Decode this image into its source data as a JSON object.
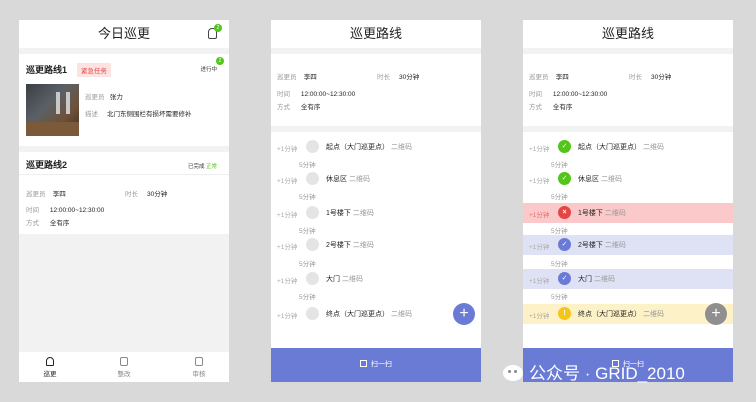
{
  "screen1": {
    "title": "今日巡更",
    "bell_badge": "2",
    "route1": {
      "name": "巡更路线1",
      "tag": "紧急任务",
      "status": "进行中",
      "status_badge": "2",
      "patroller_label": "巡更员",
      "patroller": "张力",
      "desc_label": "描述",
      "desc": "北门东侧围栏有损坏需要修补"
    },
    "route2": {
      "name": "巡更路线2",
      "status_prefix": "已完成",
      "status_value": "正常",
      "patroller_label": "巡更员",
      "patroller": "李四",
      "duration_label": "时长",
      "duration": "30分钟",
      "time_label": "时间",
      "time": "12:00:00~12:30:00",
      "mode_label": "方式",
      "mode": "全有序"
    },
    "tabs": [
      {
        "label": "巡更",
        "icon": "patrol-icon",
        "active": true
      },
      {
        "label": "整改",
        "icon": "rectify-icon",
        "active": false
      },
      {
        "label": "审核",
        "icon": "review-icon",
        "active": false
      }
    ]
  },
  "route_info": {
    "title": "巡更路线",
    "patroller_label": "巡更员",
    "patroller": "李四",
    "duration_label": "时长",
    "duration": "30分钟",
    "time_label": "时间",
    "time": "12:00:00~12:30:00",
    "mode_label": "方式",
    "mode": "全有序"
  },
  "screen2": {
    "steps": [
      {
        "time": "+1分钟",
        "name": "起点（大门巡更点）",
        "code": "二维码",
        "state": "pending"
      },
      {
        "time": "+1分钟",
        "name": "休息区",
        "code": "二维码",
        "state": "pending"
      },
      {
        "time": "+1分钟",
        "name": "1号楼下",
        "code": "二维码",
        "state": "pending"
      },
      {
        "time": "+1分钟",
        "name": "2号楼下",
        "code": "二维码",
        "state": "pending"
      },
      {
        "time": "+1分钟",
        "name": "大门",
        "code": "二维码",
        "state": "pending"
      },
      {
        "time": "+1分钟",
        "name": "终点（大门巡更点）",
        "code": "二维码",
        "state": "pending"
      }
    ],
    "gaps": [
      "5分钟",
      "5分钟",
      "5分钟",
      "5分钟",
      "5分钟"
    ],
    "scan_label": "扫一扫",
    "fab": "+"
  },
  "screen3": {
    "steps": [
      {
        "time": "+1分钟",
        "name": "起点（大门巡更点）",
        "code": "二维码",
        "state": "done",
        "mark": "✓"
      },
      {
        "time": "+1分钟",
        "name": "休息区",
        "code": "二维码",
        "state": "done",
        "mark": "✓"
      },
      {
        "time": "+1分钟",
        "name": "1号楼下",
        "code": "二维码",
        "state": "error",
        "mark": "×"
      },
      {
        "time": "+1分钟",
        "name": "2号楼下",
        "code": "二维码",
        "state": "checked",
        "mark": "✓"
      },
      {
        "time": "+1分钟",
        "name": "大门",
        "code": "二维码",
        "state": "checked",
        "mark": "✓"
      },
      {
        "time": "+1分钟",
        "name": "终点（大门巡更点）",
        "code": "二维码",
        "state": "warn",
        "mark": "!"
      }
    ],
    "gaps": [
      "5分钟",
      "5分钟",
      "5分钟",
      "5分钟",
      "5分钟"
    ],
    "scan_label": "扫一扫",
    "fab": "+"
  },
  "colors": {
    "primary": "#6a7bd6",
    "success": "#52c41a",
    "danger": "#e54545",
    "error_row": "#fbc9c9",
    "checked_row": "#dfe2f5",
    "warn_row": "#fdf1c7",
    "warn_dot": "#f5c518"
  },
  "watermark": "公众号 · GRID_2010"
}
